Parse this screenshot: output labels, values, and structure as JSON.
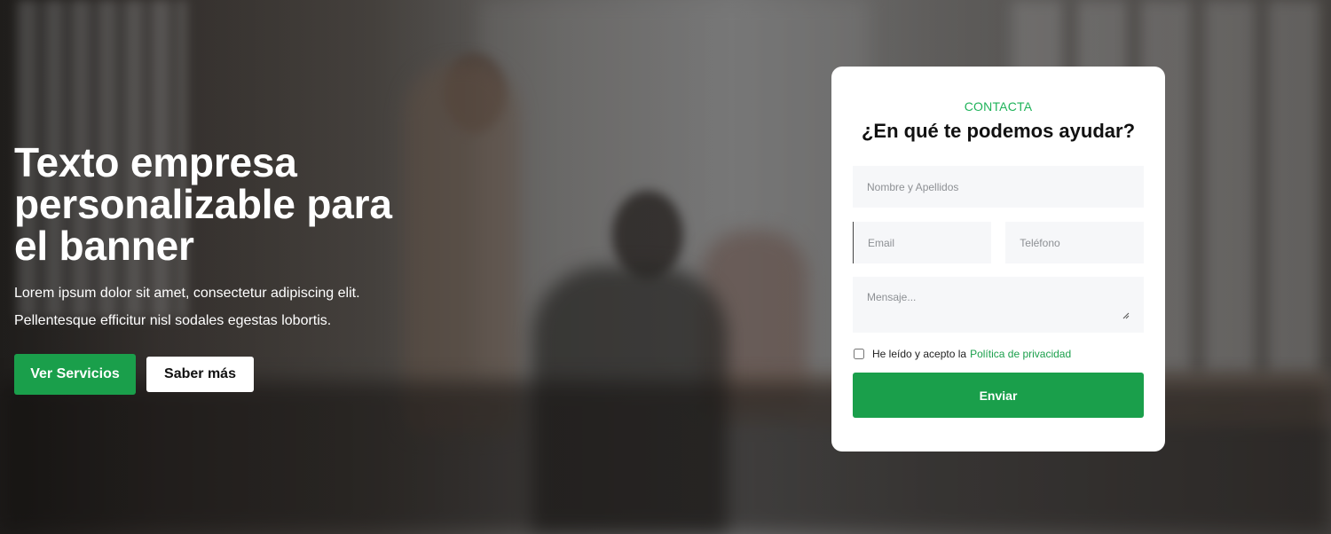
{
  "hero": {
    "title": "Texto empresa personalizable para el banner",
    "description": "Lorem ipsum dolor sit amet, consectetur adipiscing elit. Pellentesque efficitur nisl sodales egestas lobortis.",
    "primary_button": "Ver Servicios",
    "secondary_button": "Saber más"
  },
  "contact": {
    "eyebrow": "CONTACTA",
    "title": "¿En qué te podemos ayudar?",
    "name_placeholder": "Nombre y Apellidos",
    "email_placeholder": "Email",
    "phone_placeholder": "Teléfono",
    "message_placeholder": "Mensaje...",
    "consent_text": "He leído y acepto la",
    "consent_link": "Política de privacidad",
    "consent_checked": false,
    "submit_label": "Enviar"
  },
  "colors": {
    "accent": "#1a9f4b",
    "eyebrow": "#1fb35a",
    "field_bg": "#f6f7f9",
    "card_bg": "#ffffff"
  },
  "icons": {
    "textarea_resize": "resize-handle-icon"
  }
}
